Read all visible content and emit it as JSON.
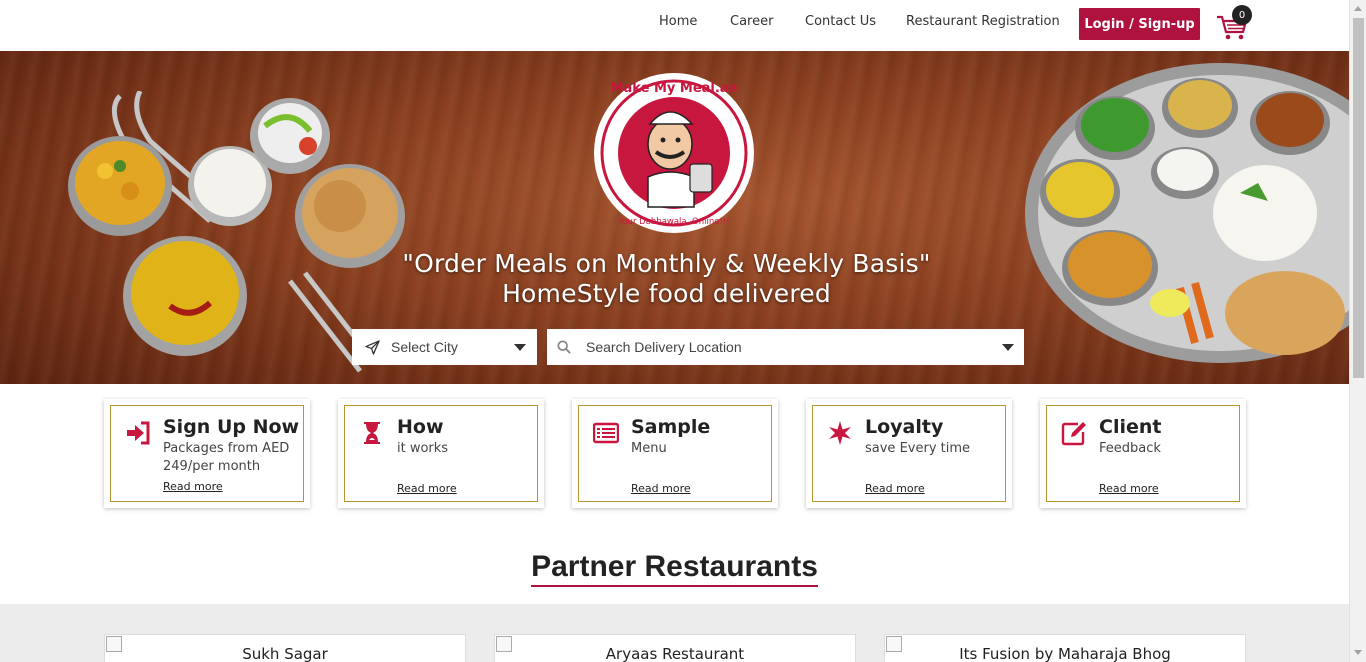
{
  "nav": {
    "links": [
      "Home",
      "Career",
      "Contact Us",
      "Restaurant Registration"
    ],
    "login_label": "Login / Sign-up",
    "cart_count": "0",
    "cart_icon": "cart-icon"
  },
  "hero": {
    "headline": "\"Order Meals on Monthly & Weekly Basis\"",
    "subheadline": "HomeStyle food delivered",
    "logo_text_top": "Make My Meal.ae",
    "logo_text_bottom": "Your Dabbawala. Online!!!",
    "city_select": {
      "value": "Select City",
      "icon": "send-icon"
    },
    "location_select": {
      "placeholder": "Search Delivery Location",
      "icon": "search-icon"
    }
  },
  "cards": [
    {
      "title": "Sign Up Now",
      "subtitle": "Packages from AED 249/per month",
      "link": "Read more",
      "icon": "sign-in-icon"
    },
    {
      "title": "How",
      "subtitle": "it works",
      "link": "Read more",
      "icon": "hourglass-icon"
    },
    {
      "title": "Sample",
      "subtitle": "Menu",
      "link": "Read more",
      "icon": "list-icon"
    },
    {
      "title": "Loyalty",
      "subtitle": "save Every time",
      "link": "Read more",
      "icon": "star-icon"
    },
    {
      "title": "Client",
      "subtitle": "Feedback",
      "link": "Read more",
      "icon": "edit-icon"
    }
  ],
  "partners": {
    "title": "Partner Restaurants",
    "restaurants": [
      "Sukh Sagar",
      "Aryaas Restaurant",
      "Its Fusion by Maharaja Bhog"
    ]
  },
  "colors": {
    "brand": "#b0123f",
    "card_border": "#b8962e"
  }
}
